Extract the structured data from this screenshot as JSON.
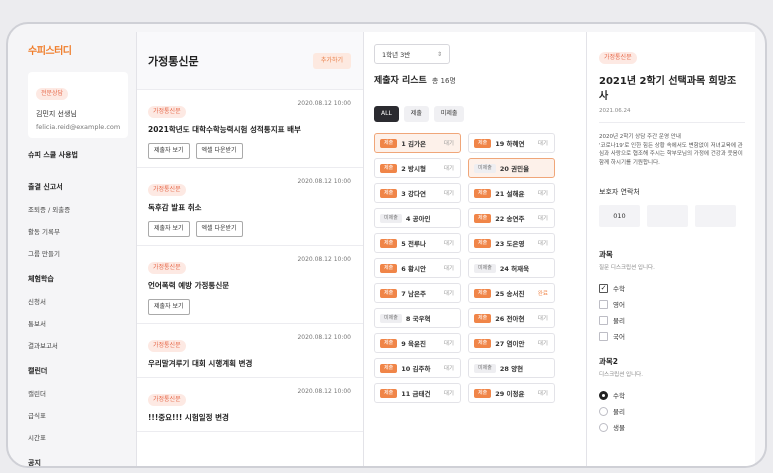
{
  "sidebar": {
    "logo": "수피스터디",
    "user": {
      "badge": "전문상담",
      "name": "김민지 선생님",
      "email": "felicia.reid@example.com"
    },
    "usage": "슈피 스쿨 사용법",
    "groups": [
      {
        "header": "출결 신고서",
        "items": [
          "조퇴증 / 외출증",
          "활동 기록부",
          "그룹 만들기"
        ]
      },
      {
        "header": "체험학습",
        "items": [
          "신청서",
          "통보서",
          "결과보고서"
        ]
      },
      {
        "header": "캘린더",
        "items": [
          "캘린더",
          "급식표",
          "시간표"
        ]
      },
      {
        "header": "공지",
        "items": []
      }
    ]
  },
  "letters": {
    "title": "가정통신문",
    "add_label": "추가하기",
    "items": [
      {
        "tag": "가정통신문",
        "date": "2020.08.12 10:00",
        "title": "2021학년도 대학수학능력시험 성적통지표 배부",
        "buttons": [
          "제출자 보기",
          "엑셀 다운받기"
        ]
      },
      {
        "tag": "가정통신문",
        "date": "2020.08.12 10:00",
        "title": "독후감 발표 취소",
        "buttons": [
          "제출자 보기",
          "엑셀 다운받기"
        ]
      },
      {
        "tag": "가정통신문",
        "date": "2020.08.12 10:00",
        "title": "언어폭력 예방 가정통신문",
        "buttons": [
          "제출자 보기"
        ]
      },
      {
        "tag": "가정통신문",
        "date": "2020.08.12 10:00",
        "title": "우리말겨루기 대회 시행계획 변경",
        "buttons": []
      },
      {
        "tag": "가정통신문",
        "date": "2020.08.12 10:00",
        "title": "!!!중요!!! 시험일정 변경",
        "buttons": []
      }
    ]
  },
  "submissions": {
    "class_select": "1학년 3반",
    "title": "제출자 리스트",
    "count": "총 16명",
    "filters": [
      "ALL",
      "제출",
      "미제출"
    ],
    "left": [
      {
        "tag": "제출",
        "name": "1 김가은",
        "status": "대기",
        "hl": true
      },
      {
        "tag": "제출",
        "name": "2 방시형",
        "status": "대기"
      },
      {
        "tag": "제출",
        "name": "3 강다연",
        "status": "대기"
      },
      {
        "tag": "미제출",
        "name": "4 공아인",
        "status": ""
      },
      {
        "tag": "제출",
        "name": "5 전루나",
        "status": "대기"
      },
      {
        "tag": "제출",
        "name": "6 황시안",
        "status": "대기"
      },
      {
        "tag": "제출",
        "name": "7 남은주",
        "status": "대기"
      },
      {
        "tag": "미제출",
        "name": "8 국우혁",
        "status": ""
      },
      {
        "tag": "제출",
        "name": "9 육윤진",
        "status": "대기"
      },
      {
        "tag": "제출",
        "name": "10 김주하",
        "status": "대기"
      },
      {
        "tag": "제출",
        "name": "11 금태건",
        "status": "대기"
      }
    ],
    "right": [
      {
        "tag": "제출",
        "name": "19 하혜연",
        "status": "대기"
      },
      {
        "tag": "미제출",
        "name": "20 권민율",
        "status": "",
        "hl": true
      },
      {
        "tag": "제출",
        "name": "21 설해윤",
        "status": "대기"
      },
      {
        "tag": "제출",
        "name": "22 송연주",
        "status": "대기"
      },
      {
        "tag": "제출",
        "name": "23 도은영",
        "status": "대기"
      },
      {
        "tag": "미제출",
        "name": "24 허재욱",
        "status": ""
      },
      {
        "tag": "제출",
        "name": "25 송서진",
        "status": "완료"
      },
      {
        "tag": "제출",
        "name": "26 전아현",
        "status": "대기"
      },
      {
        "tag": "제출",
        "name": "27 염이안",
        "status": "대기"
      },
      {
        "tag": "미제출",
        "name": "28 양현",
        "status": ""
      },
      {
        "tag": "제출",
        "name": "29 이정윤",
        "status": "대기"
      }
    ]
  },
  "survey": {
    "tag": "가정통신문",
    "title": "2021년 2학기 선택과목 희망조사",
    "date": "2021.06.24",
    "body": [
      "2020년 2학기 상담 주간 운영 안내",
      "'코로나19'로 인한 힘든 상황 속에서도 변함없이 저녀교육에 관심과 사랑으로 협조해 주시는 학부모님의 가정에 건강과 웃음이 함께 하시기를 기원합니다."
    ],
    "phone_label": "보호자 연락처",
    "phone": [
      "010",
      "",
      ""
    ],
    "q1": {
      "title": "과목",
      "desc": "질문 디스크립션 입니다.",
      "options": [
        "수학",
        "영어",
        "물리",
        "국어"
      ],
      "checked": [
        0
      ]
    },
    "q2": {
      "title": "과목2",
      "desc": "디스크립션 입니다.",
      "options": [
        "수학",
        "물리",
        "생물"
      ],
      "selected": 0
    },
    "colors": {
      "accent": "#f08548",
      "tag_bg": "#fde9e3"
    }
  }
}
